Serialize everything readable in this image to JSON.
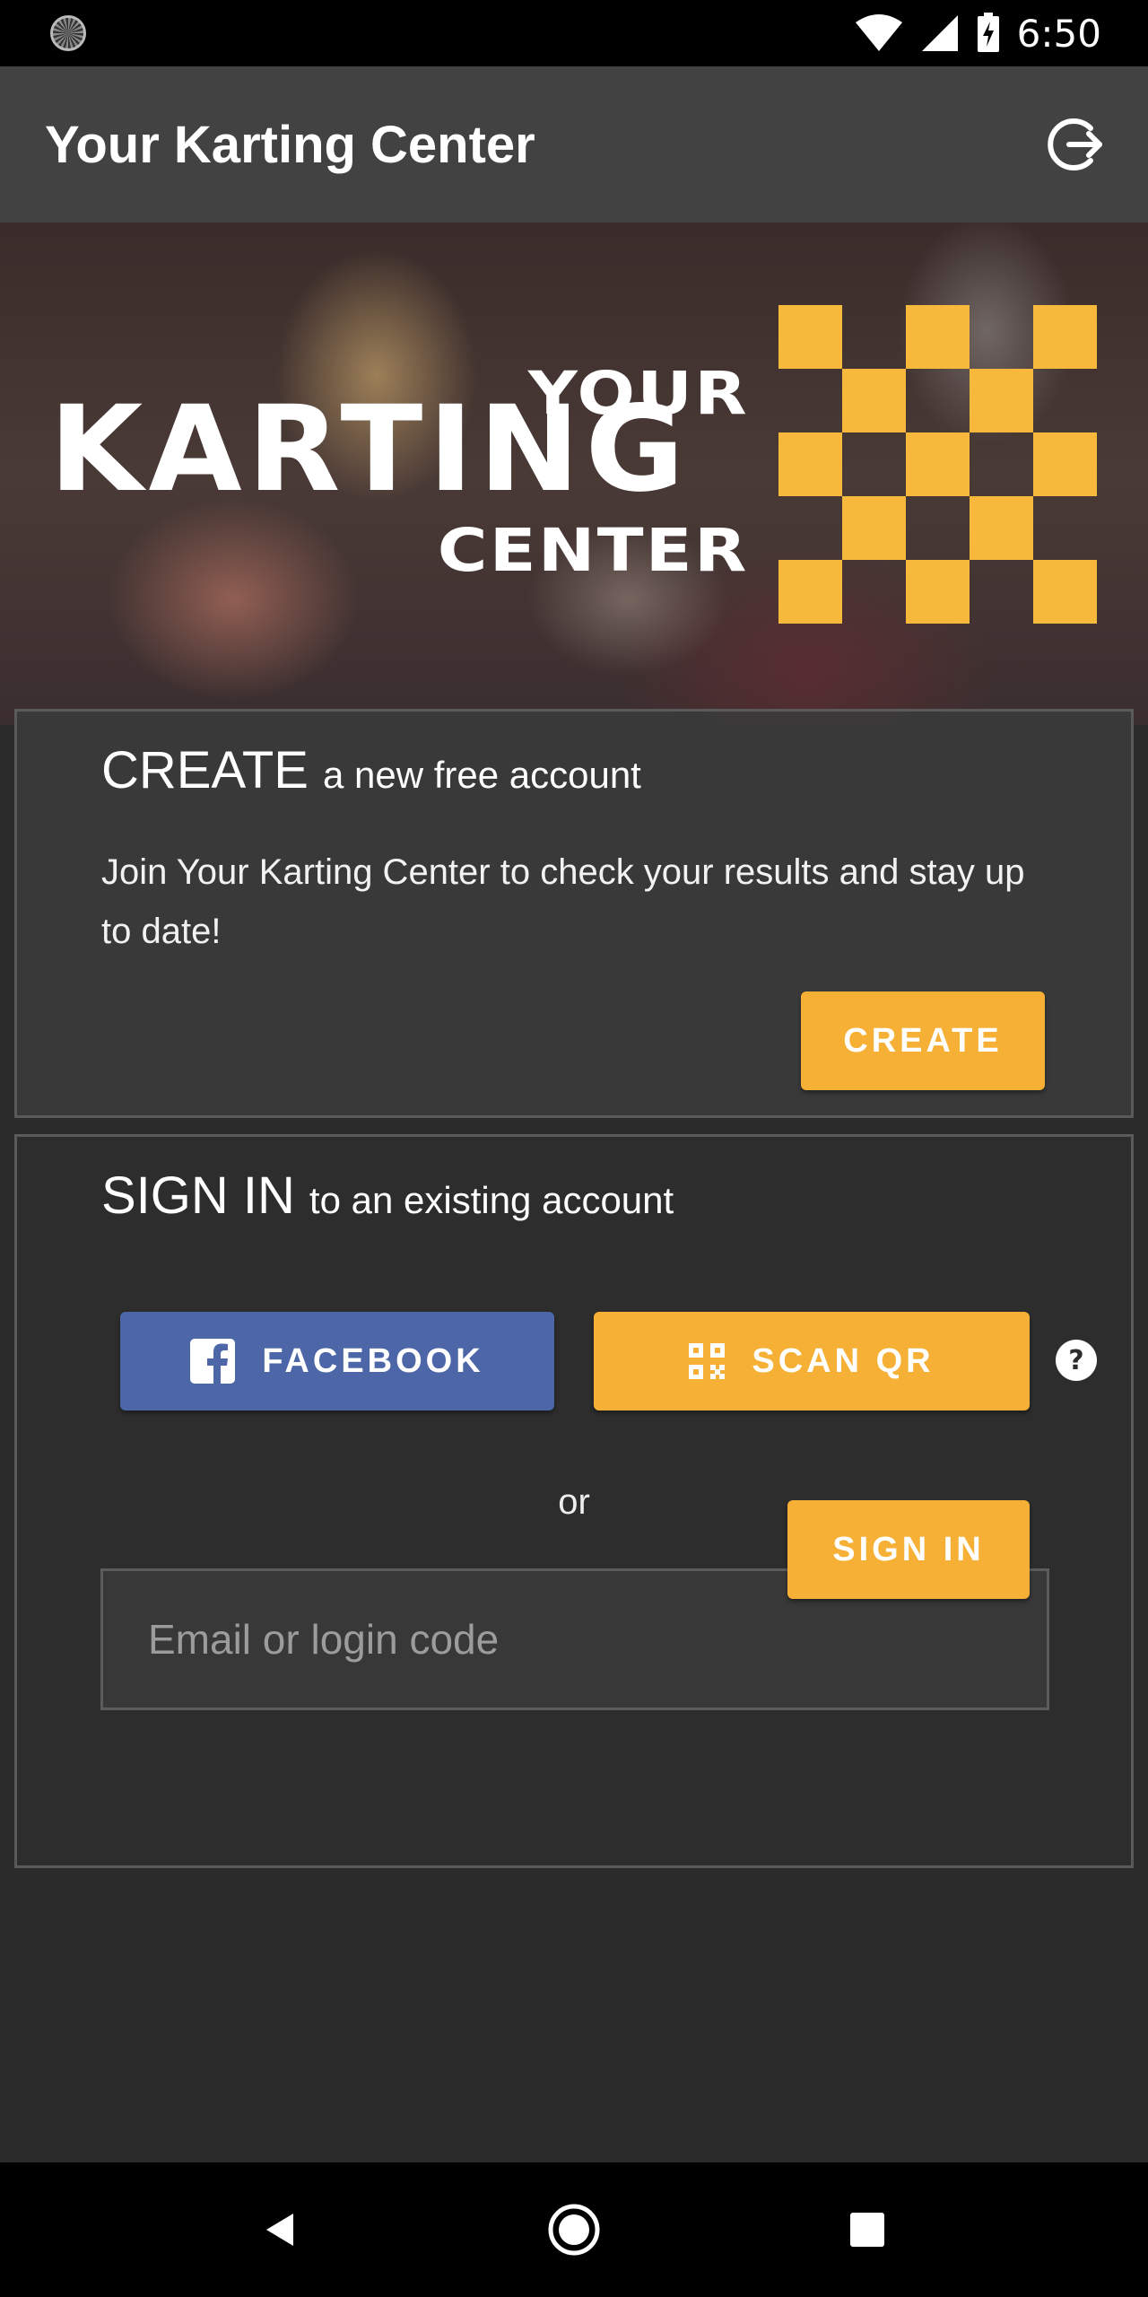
{
  "status_bar": {
    "time": "6:50"
  },
  "app_bar": {
    "title": "Your Karting Center"
  },
  "logo": {
    "line1": "YOUR",
    "line2": "KARTING",
    "line3": "CENTER",
    "checker_color": "#f6b93b"
  },
  "create_card": {
    "heading_strong": "CREATE",
    "heading_rest": "a new free account",
    "description": "Join Your Karting Center to check your results and stay up to date!",
    "button_label": "CREATE"
  },
  "signin_card": {
    "heading_strong": "SIGN IN",
    "heading_rest": "to an existing account",
    "facebook_label": "FACEBOOK",
    "scan_qr_label": "SCAN QR",
    "or_text": "or",
    "email_placeholder": "Email or login code",
    "signin_label": "SIGN IN"
  },
  "colors": {
    "accent": "#f6b035",
    "facebook": "#4d66a8",
    "app_bar": "#424242",
    "background": "#2b2b2b"
  }
}
